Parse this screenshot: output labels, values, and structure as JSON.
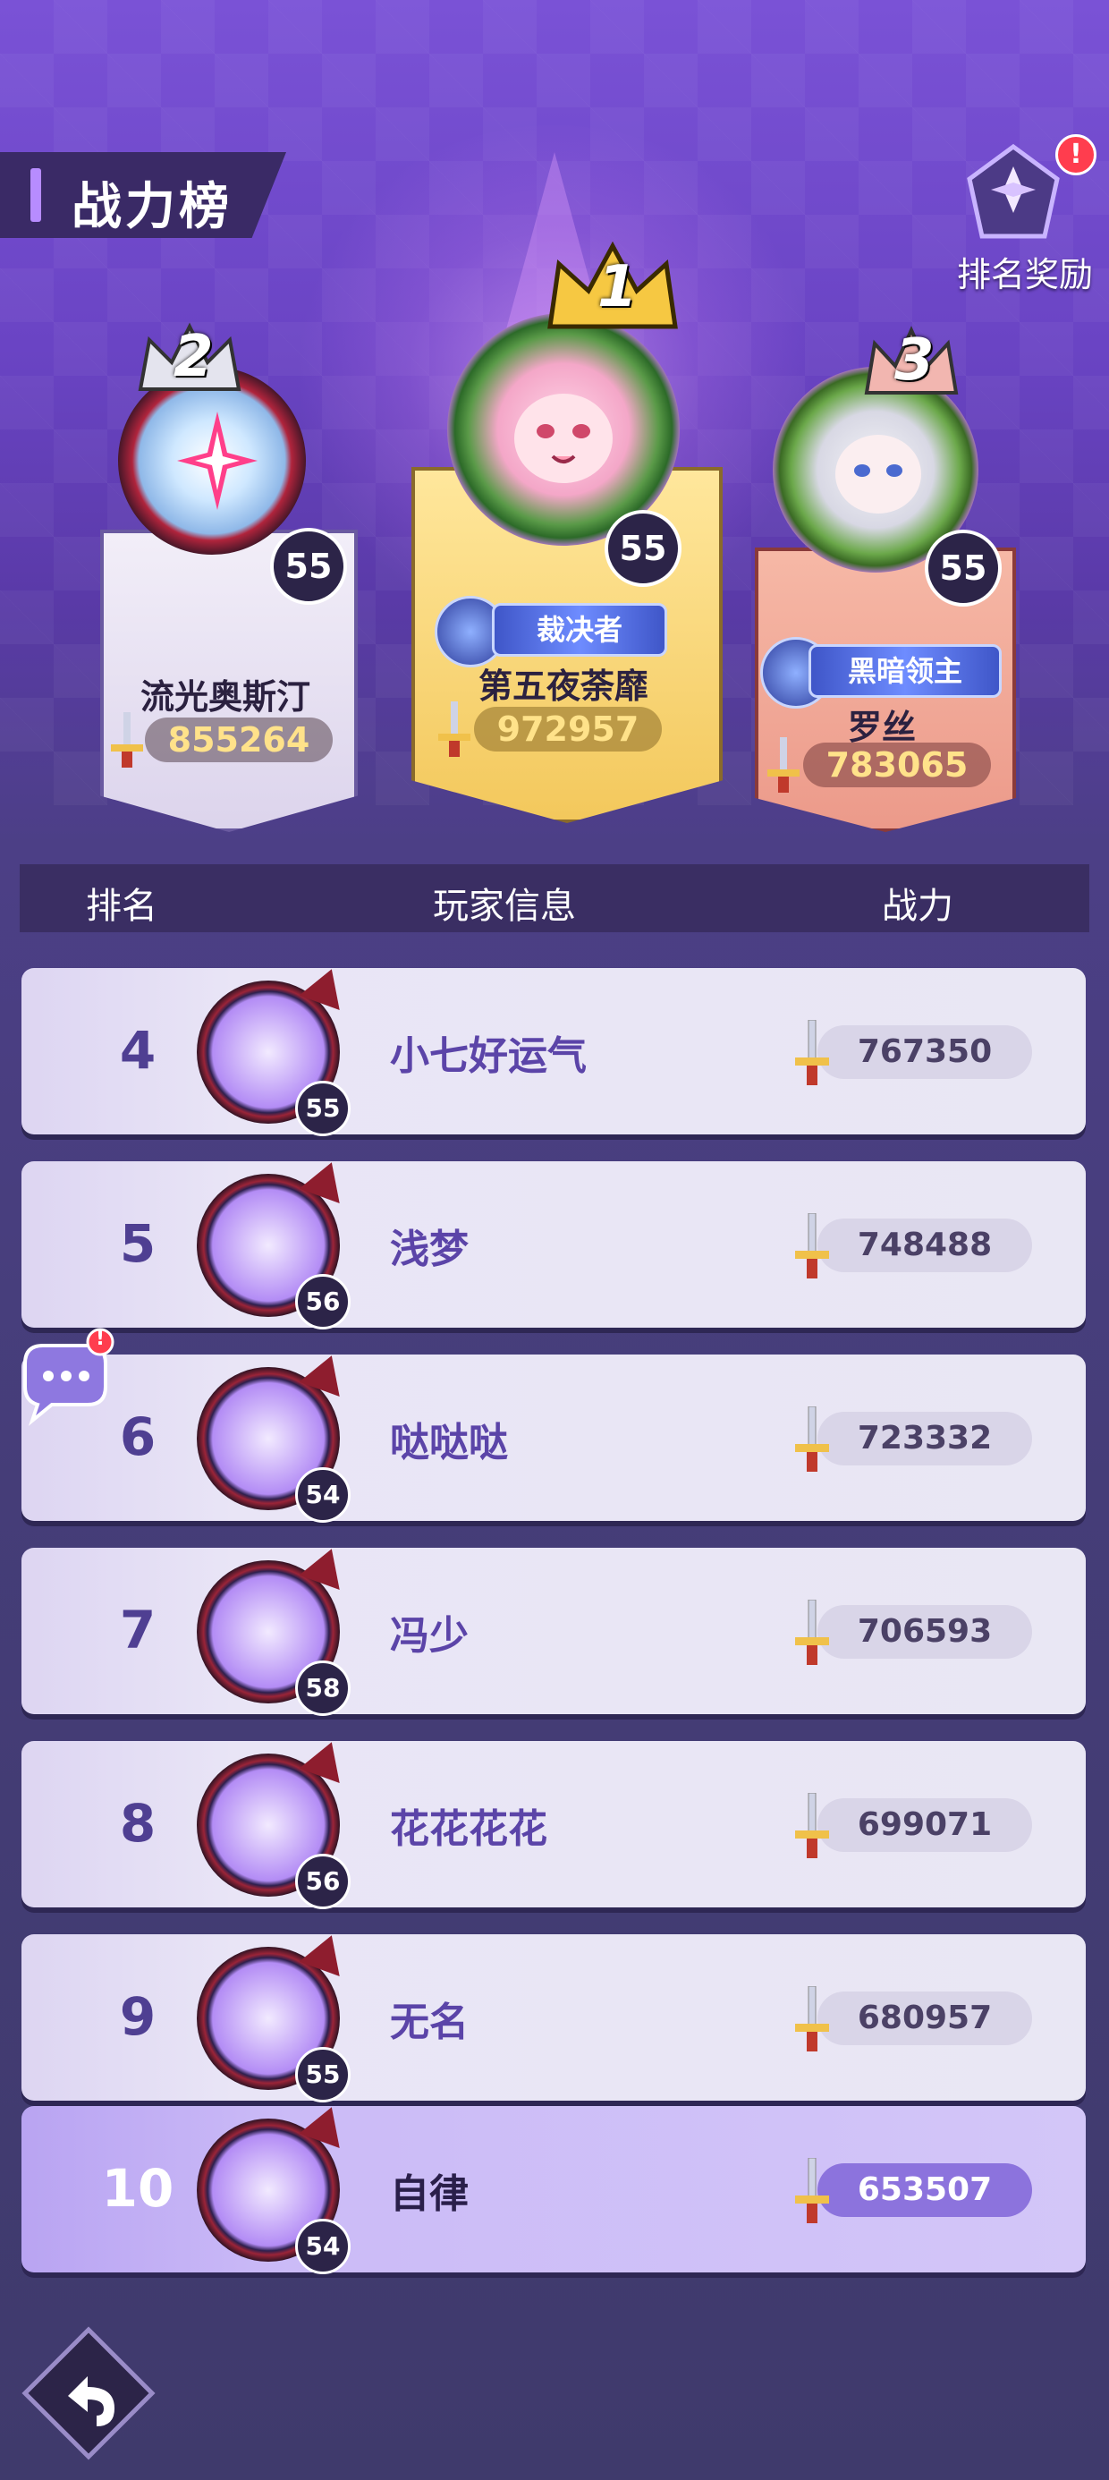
{
  "title": "战力榜",
  "reward": {
    "label": "排名奖励",
    "badge": "!"
  },
  "podium": [
    {
      "rank": "1",
      "level": "55",
      "name": "第五夜荼靡",
      "power": "972957",
      "badge": "裁决者"
    },
    {
      "rank": "2",
      "level": "55",
      "name": "流光奥斯汀",
      "power": "855264",
      "badge": ""
    },
    {
      "rank": "3",
      "level": "55",
      "name": "罗丝",
      "power": "783065",
      "badge": "黑暗领主"
    }
  ],
  "header": {
    "rank": "排名",
    "player": "玩家信息",
    "power": "战力"
  },
  "rows": [
    {
      "rank": "4",
      "level": "55",
      "name": "小七好运气",
      "power": "767350"
    },
    {
      "rank": "5",
      "level": "56",
      "name": "浅梦",
      "power": "748488"
    },
    {
      "rank": "6",
      "level": "54",
      "name": "哒哒哒",
      "power": "723332"
    },
    {
      "rank": "7",
      "level": "58",
      "name": "冯少",
      "power": "706593"
    },
    {
      "rank": "8",
      "level": "56",
      "name": "花花花花",
      "power": "699071"
    },
    {
      "rank": "9",
      "level": "55",
      "name": "无名",
      "power": "680957"
    },
    {
      "rank": "10",
      "level": "54",
      "name": "自律",
      "power": "653507"
    }
  ],
  "chat_badge": "!",
  "colors": {
    "accent": "#7a52d6",
    "gold": "#ffe28a",
    "row_text": "#5b44a8",
    "alert": "#ff3d4e"
  },
  "icons": {
    "reward": "trophy-icon",
    "power": "sword-icon",
    "chat": "chat-bubble-icon",
    "back": "back-arrow-icon"
  }
}
